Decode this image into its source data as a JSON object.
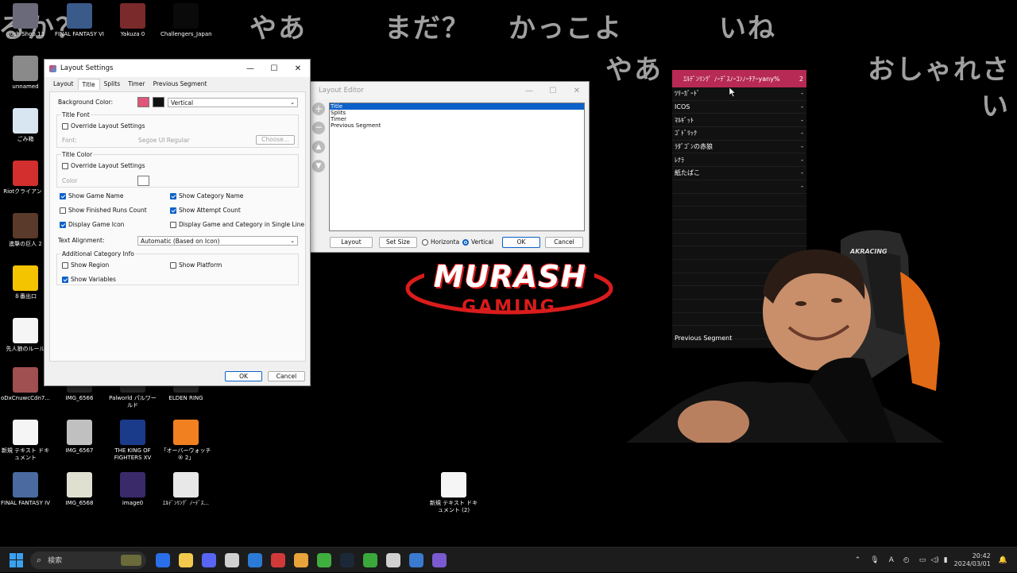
{
  "chat_overlay": [
    "るか？",
    "やあ",
    "まだ？",
    "かっこよ",
    "いね",
    "やあ",
    "おしゃれさ",
    "い"
  ],
  "desktop_icons": [
    {
      "label": "gush Shop 13",
      "color": "#6a6a7a"
    },
    {
      "label": "FINAL FANTASY VI",
      "color": "#3a5a8a"
    },
    {
      "label": "Yakuza 0",
      "color": "#7a2a2a"
    },
    {
      "label": "Challengers_Japan",
      "color": "#0a0a0a"
    },
    {
      "label": "unnamed",
      "color": "#8a8a8a"
    },
    {
      "label": "ごみ箱",
      "color": "#d8e6f2"
    },
    {
      "label": "Riotクライアント",
      "color": "#d32f2f"
    },
    {
      "label": "進撃の巨人 2",
      "color": "#5a3a2a"
    },
    {
      "label": "８番出口",
      "color": "#f5c400"
    },
    {
      "label": "先人狼のルール",
      "color": "#f5f5f5"
    },
    {
      "label": "oDxCnuwcCdn7...",
      "color": "#a05050"
    },
    {
      "label": "IMG_6566",
      "color": "#2a2a2a"
    },
    {
      "label": "Palworld パルワールド",
      "color": "#2a2a2a"
    },
    {
      "label": "ELDEN RING",
      "color": "#2a2a2a"
    },
    {
      "label": "新規 テキスト ドキュメント",
      "color": "#f5f5f5"
    },
    {
      "label": "IMG_6567",
      "color": "#c0c0c0"
    },
    {
      "label": "THE KING OF FIGHTERS XV",
      "color": "#1a3a8a"
    },
    {
      "label": "「オーバーウォッチ® 2」",
      "color": "#f08020"
    },
    {
      "label": "FINAL FANTASY IV",
      "color": "#4a6aa0"
    },
    {
      "label": "IMG_6568",
      "color": "#e0e0d0"
    },
    {
      "label": "image0",
      "color": "#3a2a6a"
    },
    {
      "label": "ｴﾙﾃﾞﾝﾘﾝｸﾞ ﾉｰﾃﾞｽ...",
      "color": "#e8e8e8"
    },
    {
      "label": "新規 テキスト ドキュメント (2)",
      "color": "#f5f5f5"
    }
  ],
  "layout_settings": {
    "title": "Layout Settings",
    "tabs": [
      "Layout",
      "Title",
      "Splits",
      "Timer",
      "Previous Segment"
    ],
    "background_color_label": "Background Color:",
    "background_gradient": "Vertical",
    "color1": "#e0567a",
    "color2": "#111111",
    "title_font_group": "Title Font",
    "override_layout_1": "Override Layout Settings",
    "font_label": "Font:",
    "font_value": "Segoe UI Regular",
    "choose_button": "Choose...",
    "title_color_group": "Title Color",
    "override_layout_2": "Override Layout Settings",
    "color_label": "Color",
    "show_game_name": "Show Game Name",
    "show_category_name": "Show Category Name",
    "show_finished_runs": "Show Finished Runs Count",
    "show_attempt_count": "Show Attempt Count",
    "display_game_icon": "Display Game Icon",
    "display_single_line": "Display Game and Category in Single Line",
    "text_alignment_label": "Text Alignment:",
    "text_alignment_value": "Automatic (Based on Icon)",
    "additional_group": "Additional Category Info",
    "show_region": "Show Region",
    "show_platform": "Show Platform",
    "show_variables": "Show Variables",
    "ok": "OK",
    "cancel": "Cancel"
  },
  "layout_editor": {
    "title": "Layout Editor",
    "items": [
      "Title",
      "Splits",
      "Timer",
      "Previous Segment"
    ],
    "selected_index": 0,
    "layout_button": "Layout",
    "set_size_button": "Set Size",
    "horizontal": "Horizonta",
    "vertical": "Vertical",
    "ok": "OK",
    "cancel": "Cancel"
  },
  "splits": {
    "header": "ｴﾙﾃﾞﾝﾘﾝｸﾞ ﾉｰﾃﾞｽﾉｰｺﾝﾉｰﾁｱｰyany%",
    "header_count": "2",
    "rows": [
      "ﾂﾘｰｶﾞｰﾄﾞ",
      "ICOS",
      "ﾏﾙｷﾞｯﾄ",
      "ｺﾞﾄﾞﾘｯｸ",
      "ﾗﾀﾞｺﾞﾝの赤狼",
      "ﾚﾅﾗ",
      "紙たばこ",
      ""
    ],
    "previous_segment": "Previous Segment",
    "dash": "-"
  },
  "logo": {
    "line1": "MURASH",
    "line2": "GAMING"
  },
  "chair_brand": "AKRACING",
  "taskbar": {
    "search_placeholder": "検索",
    "tray_letter": "A",
    "time": "20:42",
    "date": "2024/03/01",
    "app_colors": [
      "#2a6ee8",
      "#f2c94c",
      "#5865f2",
      "#d0d0d0",
      "#2b7bd6",
      "#d23a3a",
      "#e8a33a",
      "#3fae3f",
      "#1b2838",
      "#3aa83a",
      "#d0d0d0",
      "#3a7ad0",
      "#7a5ad0"
    ]
  }
}
